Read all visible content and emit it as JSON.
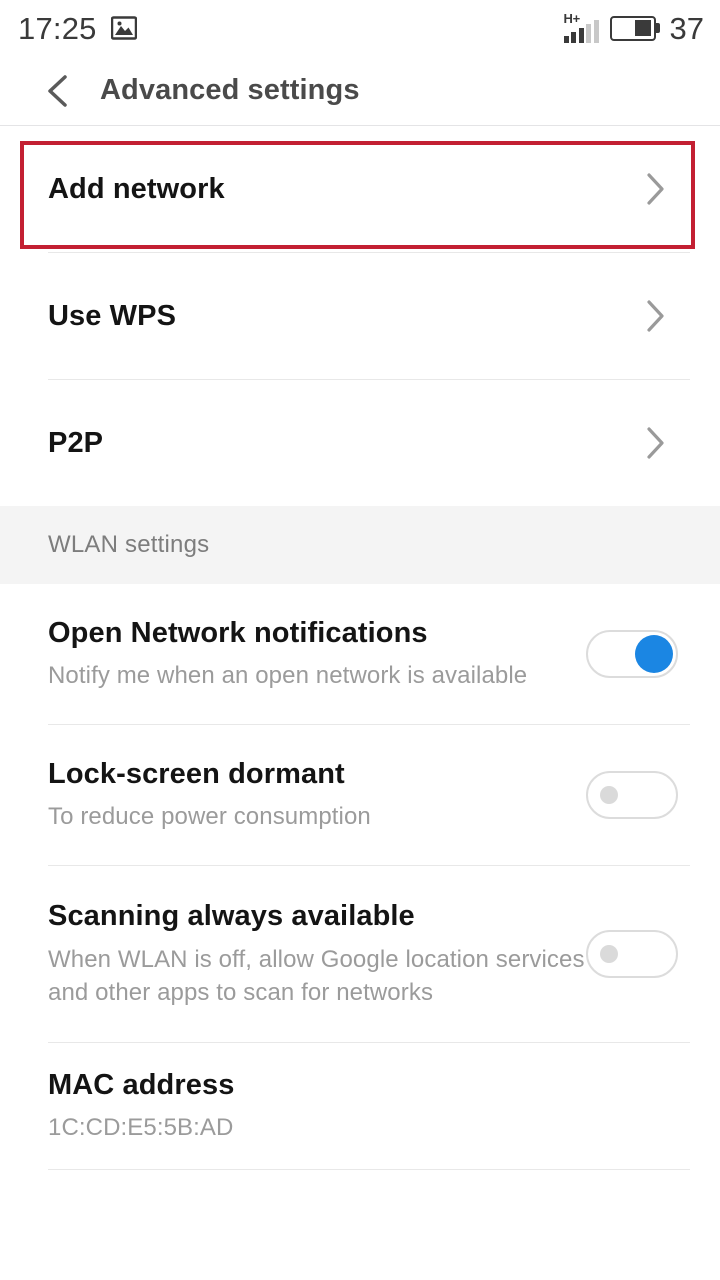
{
  "status_bar": {
    "time": "17:25",
    "photo_icon": "image-icon",
    "network_type": "H+",
    "signal_icon": "signal-bars-icon",
    "signal_bars_total": 5,
    "signal_bars_filled": 3,
    "battery_icon": "battery-icon",
    "battery_level": "37"
  },
  "app_bar": {
    "back_icon": "back-chevron-icon",
    "title": "Advanced settings"
  },
  "colors": {
    "accent": "#1b86e3",
    "annotation": "#c32032",
    "section_background": "#f4f4f4",
    "title_text": "#141414",
    "summary_text": "#9b9b9b"
  },
  "top_items": [
    {
      "title": "Add network",
      "icon": "chevron-right-icon",
      "highlighted": true
    },
    {
      "title": "Use WPS",
      "icon": "chevron-right-icon",
      "highlighted": false
    },
    {
      "title": "P2P",
      "icon": "chevron-right-icon",
      "highlighted": false
    }
  ],
  "section": {
    "header": "WLAN settings"
  },
  "settings": [
    {
      "title": "Open Network notifications",
      "summary": "Notify me when an open network is available",
      "control": "toggle",
      "state": "on"
    },
    {
      "title": "Lock-screen dormant",
      "summary": "To reduce power consumption",
      "control": "toggle",
      "state": "off"
    },
    {
      "title": "Scanning always available",
      "summary": "When WLAN is off, allow Google location services and other apps to scan for networks",
      "control": "toggle",
      "state": "off"
    },
    {
      "title": "MAC address",
      "summary": "1C:CD:E5:5B:AD",
      "control": "none",
      "state": ""
    }
  ]
}
